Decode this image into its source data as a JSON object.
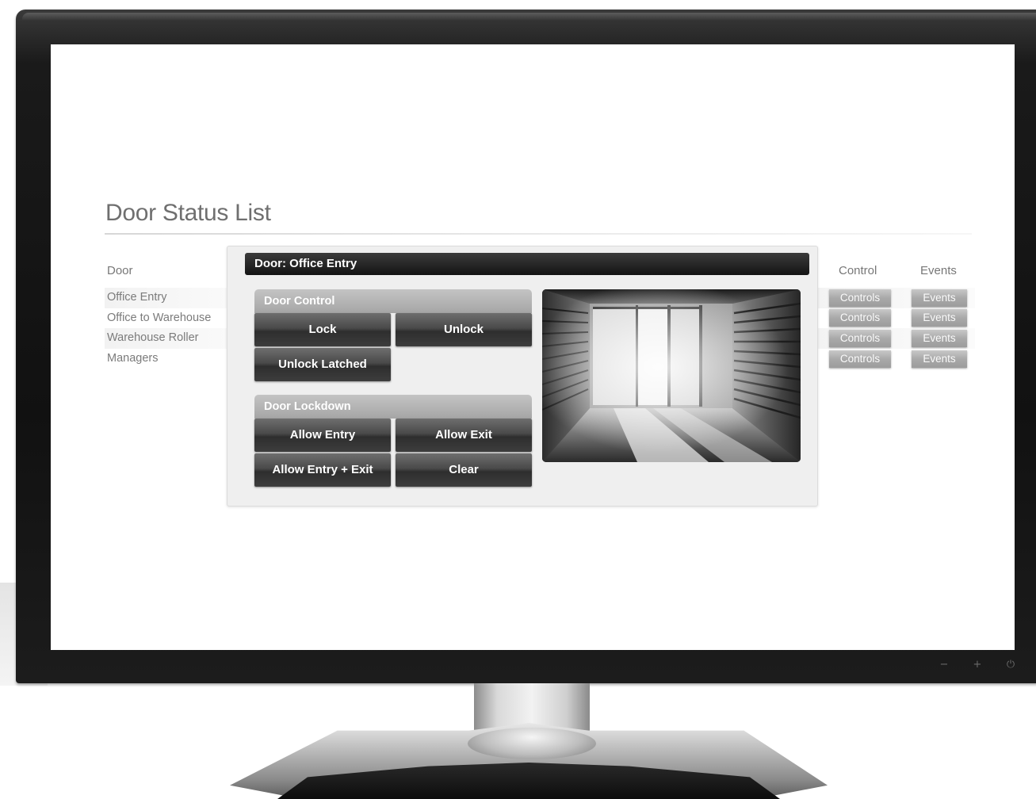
{
  "page": {
    "title": "Door Status List"
  },
  "columns": {
    "door": "Door",
    "control": "Control",
    "events": "Events"
  },
  "doors": [
    {
      "name": "Office Entry",
      "control_label": "Controls",
      "events_label": "Events"
    },
    {
      "name": "Office to Warehouse",
      "control_label": "Controls",
      "events_label": "Events"
    },
    {
      "name": "Warehouse Roller",
      "control_label": "Controls",
      "events_label": "Events"
    },
    {
      "name": "Managers",
      "control_label": "Controls",
      "events_label": "Events"
    }
  ],
  "panel": {
    "header": "Door: Office Entry",
    "door_control": {
      "title": "Door Control",
      "lock": "Lock",
      "unlock": "Unlock",
      "unlock_latched": "Unlock Latched"
    },
    "door_lockdown": {
      "title": "Door Lockdown",
      "allow_entry": "Allow Entry",
      "allow_exit": "Allow Exit",
      "allow_entry_exit": "Allow Entry + Exit",
      "clear": "Clear"
    }
  },
  "monitor": {
    "minus": "−",
    "plus": "+",
    "power": "⏻"
  },
  "colors": {
    "panel_header": "#1e1e1e",
    "button_dark": "#3d3d3d",
    "button_gray": "#a9a9a9",
    "section_head": "#b4b4b4"
  },
  "icons": [
    "camera-feed-image",
    "minus-icon",
    "plus-icon",
    "power-icon"
  ]
}
